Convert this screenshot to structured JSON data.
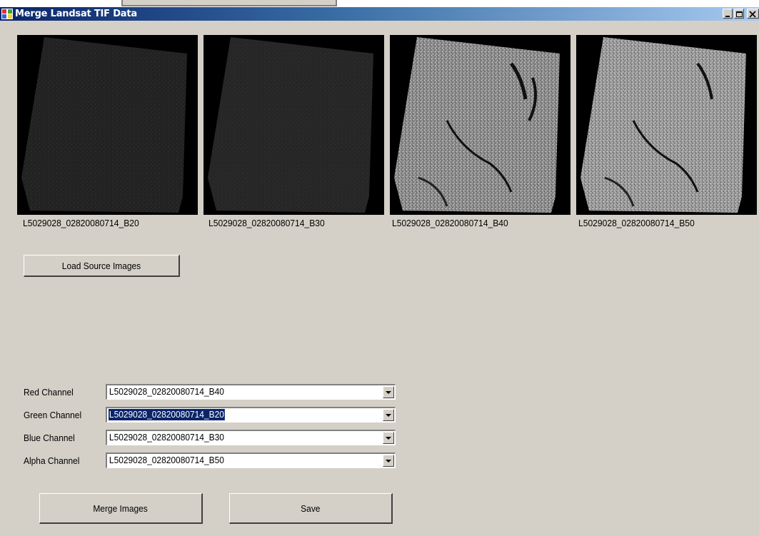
{
  "window": {
    "title": "Merge Landsat TIF Data"
  },
  "thumbnails": [
    {
      "label": "L5029028_02820080714_B20",
      "shade": "dark"
    },
    {
      "label": "L5029028_02820080714_B30",
      "shade": "dark"
    },
    {
      "label": "L5029028_02820080714_B40",
      "shade": "bright"
    },
    {
      "label": "L5029028_02820080714_B50",
      "shade": "bright"
    }
  ],
  "buttons": {
    "load": "Load Source Images",
    "merge": "Merge Images",
    "save": "Save"
  },
  "channels": [
    {
      "label": "Red Channel",
      "value": "L5029028_02820080714_B40",
      "selected": false
    },
    {
      "label": "Green Channel",
      "value": "L5029028_02820080714_B20",
      "selected": true
    },
    {
      "label": "Blue Channel",
      "value": "L5029028_02820080714_B30",
      "selected": false
    },
    {
      "label": "Alpha Channel",
      "value": "L5029028_02820080714_B50",
      "selected": false
    }
  ],
  "colors": {
    "title_gradient_start": "#0a246a",
    "title_gradient_end": "#a6caf0",
    "window_bg": "#d4d0c8",
    "selection": "#0a246a"
  }
}
